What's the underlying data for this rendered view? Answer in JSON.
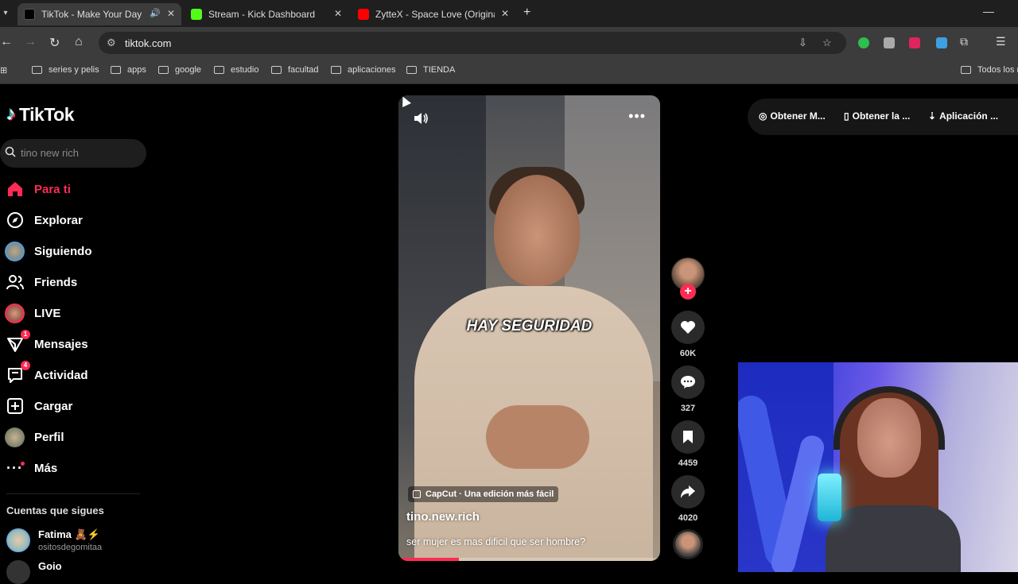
{
  "browser": {
    "tabs": [
      {
        "label": "TikTok - Make Your Day",
        "icon": "tiktok-icon",
        "active": true
      },
      {
        "label": "Stream - Kick Dashboard",
        "icon": "kick-icon",
        "active": false
      },
      {
        "label": "ZytteX - Space Love (Original M",
        "icon": "youtube-icon",
        "active": false
      }
    ],
    "url": "tiktok.com",
    "bookmarks": [
      "series y pelis",
      "apps",
      "google",
      "estudio",
      "facultad",
      "aplicaciones",
      "TIENDA"
    ],
    "other_bookmarks": "Todos los m"
  },
  "tiktok": {
    "logo": "TikTok",
    "search_placeholder": "tino new rich",
    "nav": [
      {
        "label": "Para ti",
        "icon": "home-icon",
        "active": true
      },
      {
        "label": "Explorar",
        "icon": "compass-icon"
      },
      {
        "label": "Siguiendo",
        "icon": "following-avatar-icon"
      },
      {
        "label": "Friends",
        "icon": "friends-icon"
      },
      {
        "label": "LIVE",
        "icon": "live-avatar-icon"
      },
      {
        "label": "Mensajes",
        "icon": "messages-icon",
        "badge": "1"
      },
      {
        "label": "Actividad",
        "icon": "activity-icon",
        "badge": "4"
      },
      {
        "label": "Cargar",
        "icon": "upload-icon"
      },
      {
        "label": "Perfil",
        "icon": "profile-avatar-icon"
      },
      {
        "label": "Más",
        "icon": "more-icon"
      }
    ],
    "following_title": "Cuentas que sigues",
    "following": [
      {
        "name": "Fatima 🧸⚡",
        "username": "ositosdegomitaa"
      },
      {
        "name": "Goio",
        "username": ""
      }
    ],
    "top_right": [
      "Obtener M...",
      "Obtener la ...",
      "Aplicación ..."
    ],
    "video": {
      "caption": "HAY SEGURIDAD",
      "capcut": "CapCut · Una edición más fácil",
      "username": "tino.new.rich",
      "description": "ser mujer es mas dificil que ser hombre?",
      "progress": 0.23
    },
    "actions": {
      "likes": "60K",
      "comments": "327",
      "saves": "4459",
      "shares": "4020"
    }
  },
  "colors": {
    "accent": "#fe2c55",
    "chrome_bg": "#1f1f1f",
    "toolbar_bg": "#3c3c3c"
  }
}
